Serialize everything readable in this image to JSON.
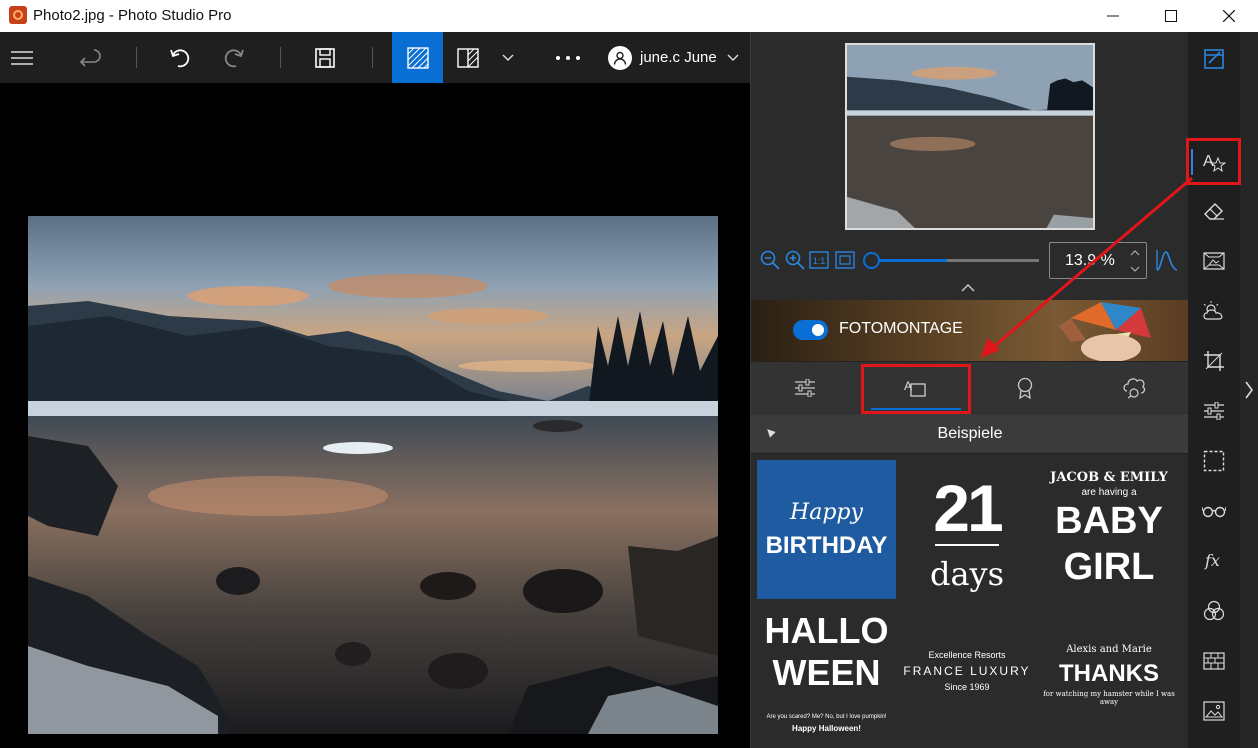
{
  "window": {
    "title": "Photo2.jpg - Photo Studio Pro"
  },
  "toolbar": {
    "user_label": "june.c June",
    "more_label": "…"
  },
  "zoom": {
    "value": "13.9 %",
    "slider_fraction": 0.45
  },
  "banner": {
    "label": "FOTOMONTAGE",
    "toggle_on": true
  },
  "section": {
    "title": "Beispiele"
  },
  "templates": {
    "birthday": {
      "line1": "Happy",
      "line2": "BIRTHDAY"
    },
    "countdown": {
      "number": "21",
      "unit": "days"
    },
    "baby": {
      "names": "JACOB & EMILY",
      "sub": "are having a",
      "line1": "BABY",
      "line2": "GIRL"
    },
    "halloween": {
      "line1": "HALLO",
      "line2": "WEEN",
      "small": "Are you scared? Me? No, but I love pumpkin!",
      "small2": "Happy Halloween!"
    },
    "luxury": {
      "top": "Excellence Resorts",
      "main": "FRANCE LUXURY",
      "bottom": "Since 1969"
    },
    "thanks": {
      "names": "Alexis and Marie",
      "main": "THANKS",
      "bottom": "for watching my hamster while I was away"
    }
  },
  "colors": {
    "accent": "#0a6fd4",
    "highlight": "#e0161b",
    "panel_bg": "#2b2b2b",
    "toolbar_bg": "#1f1f1f"
  }
}
